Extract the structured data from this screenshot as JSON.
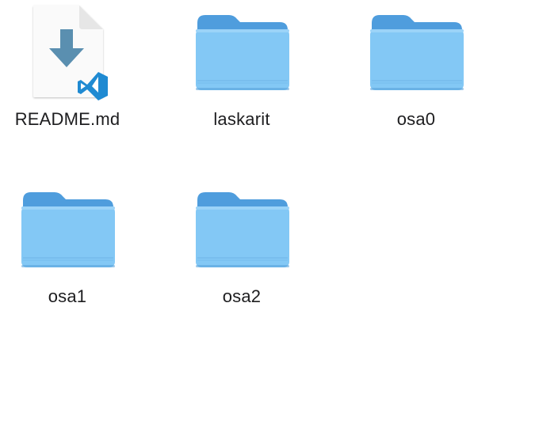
{
  "items": [
    {
      "name": "README.md",
      "kind": "markdown-file",
      "icon": "markdown-file-vscode-icon"
    },
    {
      "name": "laskarit",
      "kind": "folder",
      "icon": "folder-icon"
    },
    {
      "name": "osa0",
      "kind": "folder",
      "icon": "folder-icon"
    },
    {
      "name": "osa1",
      "kind": "folder",
      "icon": "folder-icon"
    },
    {
      "name": "osa2",
      "kind": "folder",
      "icon": "folder-icon"
    }
  ],
  "colors": {
    "folder_back": "#4f9ddd",
    "folder_front": "#83c8f5",
    "folder_line": "#6fb3e8",
    "download_arrow": "#5a8fb0",
    "vscode_blue": "#1f8ad2",
    "label_text": "#1d1d1f"
  }
}
